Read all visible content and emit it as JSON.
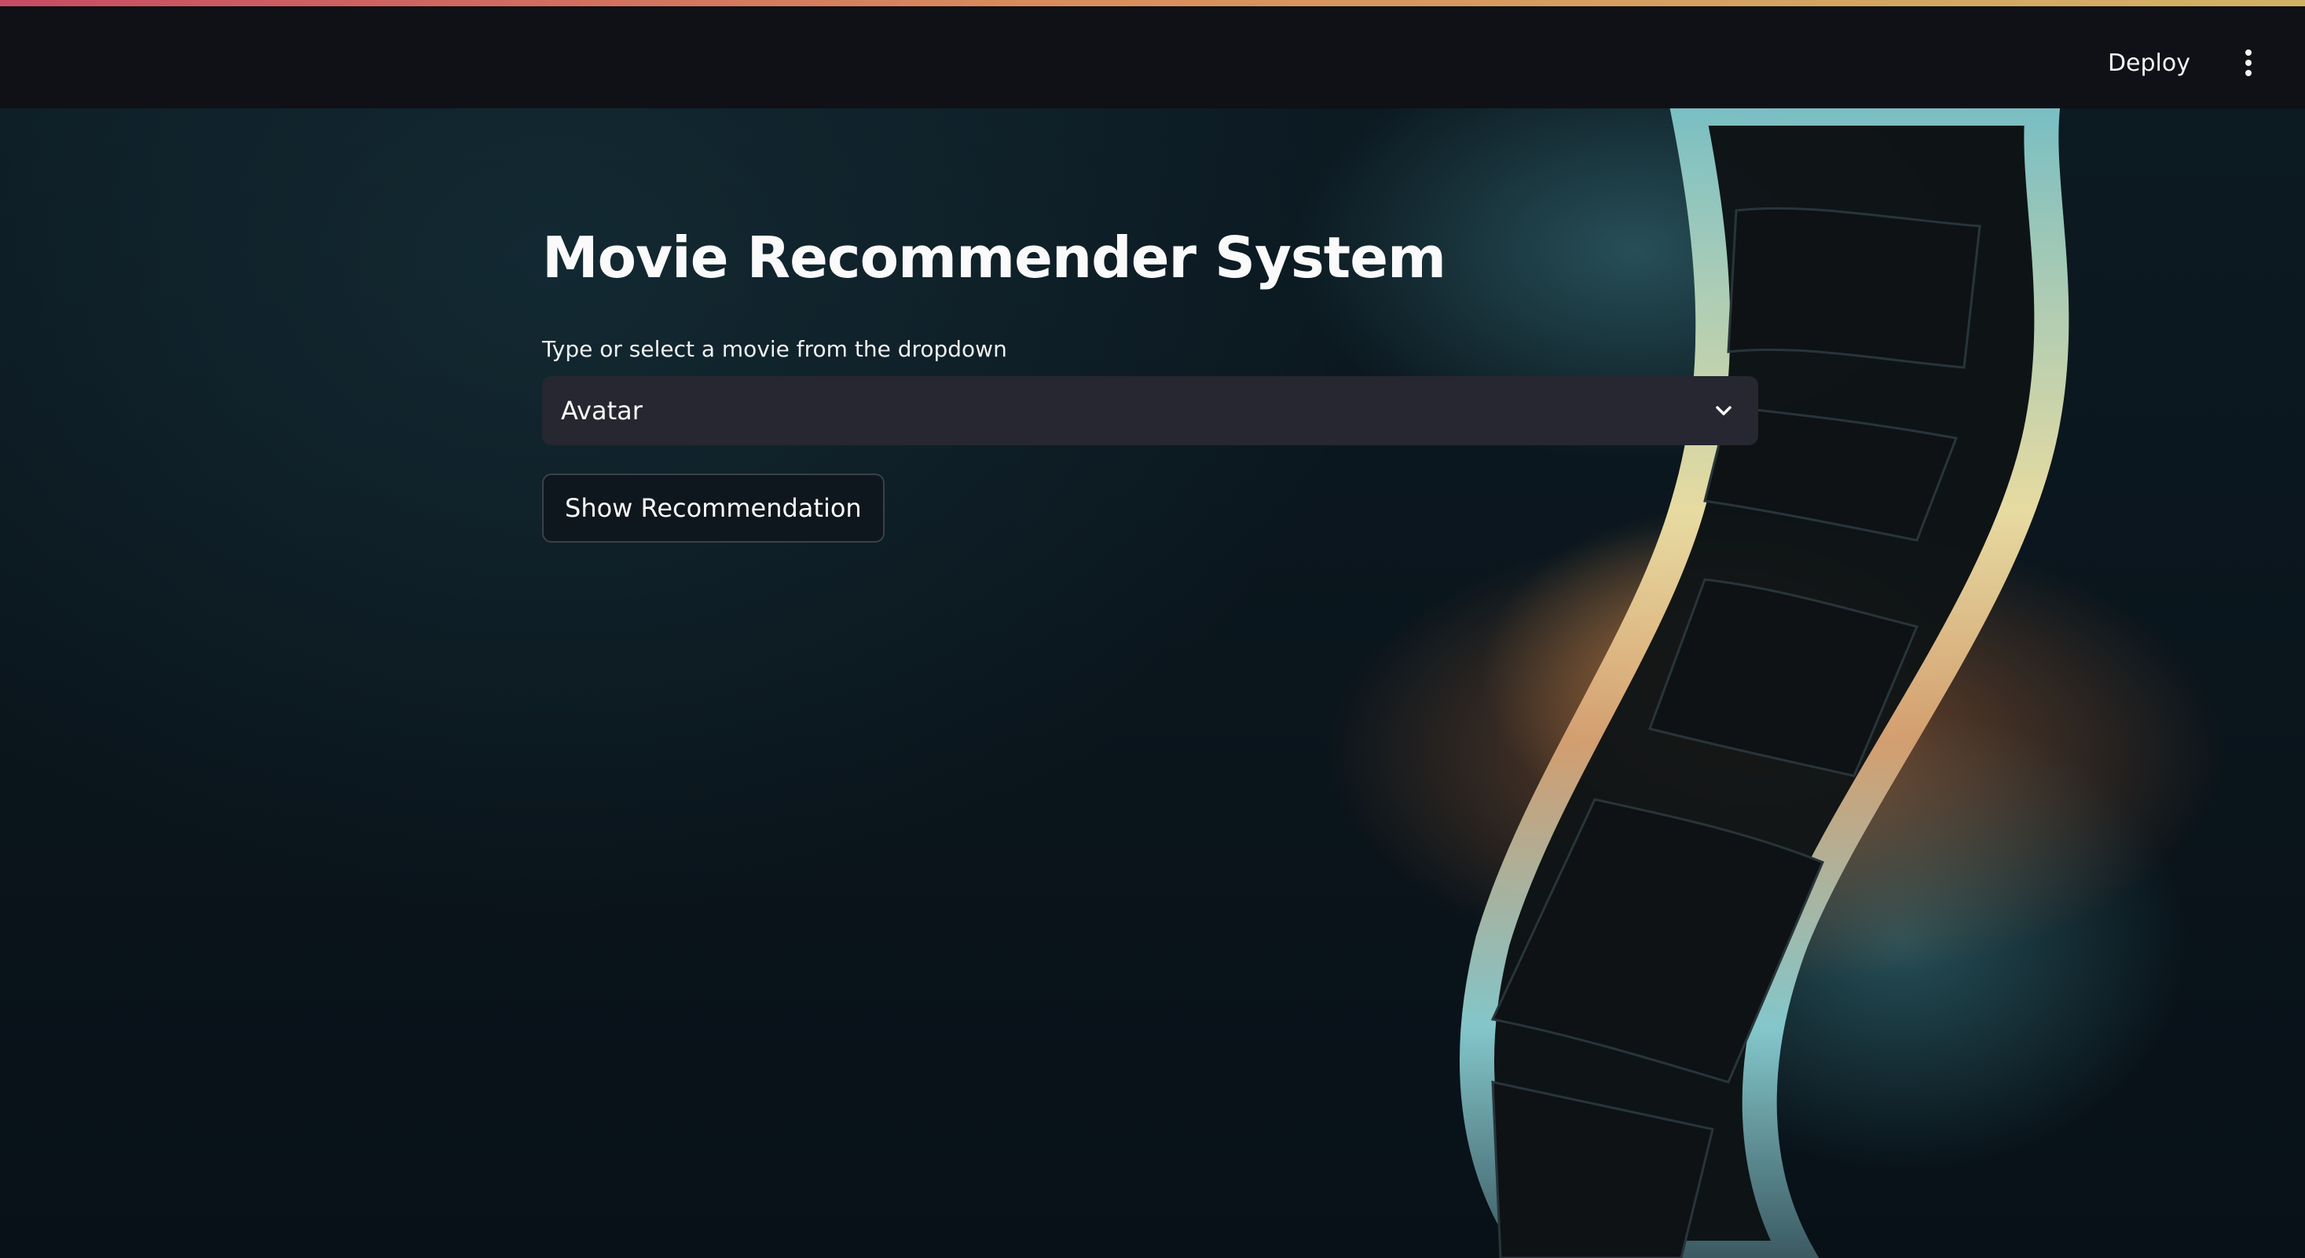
{
  "header": {
    "deploy_label": "Deploy",
    "menu_icon": "kebab-menu-icon"
  },
  "main": {
    "title": "Movie Recommender System",
    "select": {
      "label": "Type or select a movie from the dropdown",
      "value": "Avatar",
      "icon": "chevron-down-icon"
    },
    "button_label": "Show Recommendation"
  },
  "background": {
    "image": "film-strip-illustration",
    "accent_warm": "#d6783c",
    "accent_cool": "#5ab4be"
  },
  "colors": {
    "header_bg": "#0f1116",
    "page_bg": "#0b141b",
    "select_bg": "#262730",
    "text": "#fafafa"
  }
}
